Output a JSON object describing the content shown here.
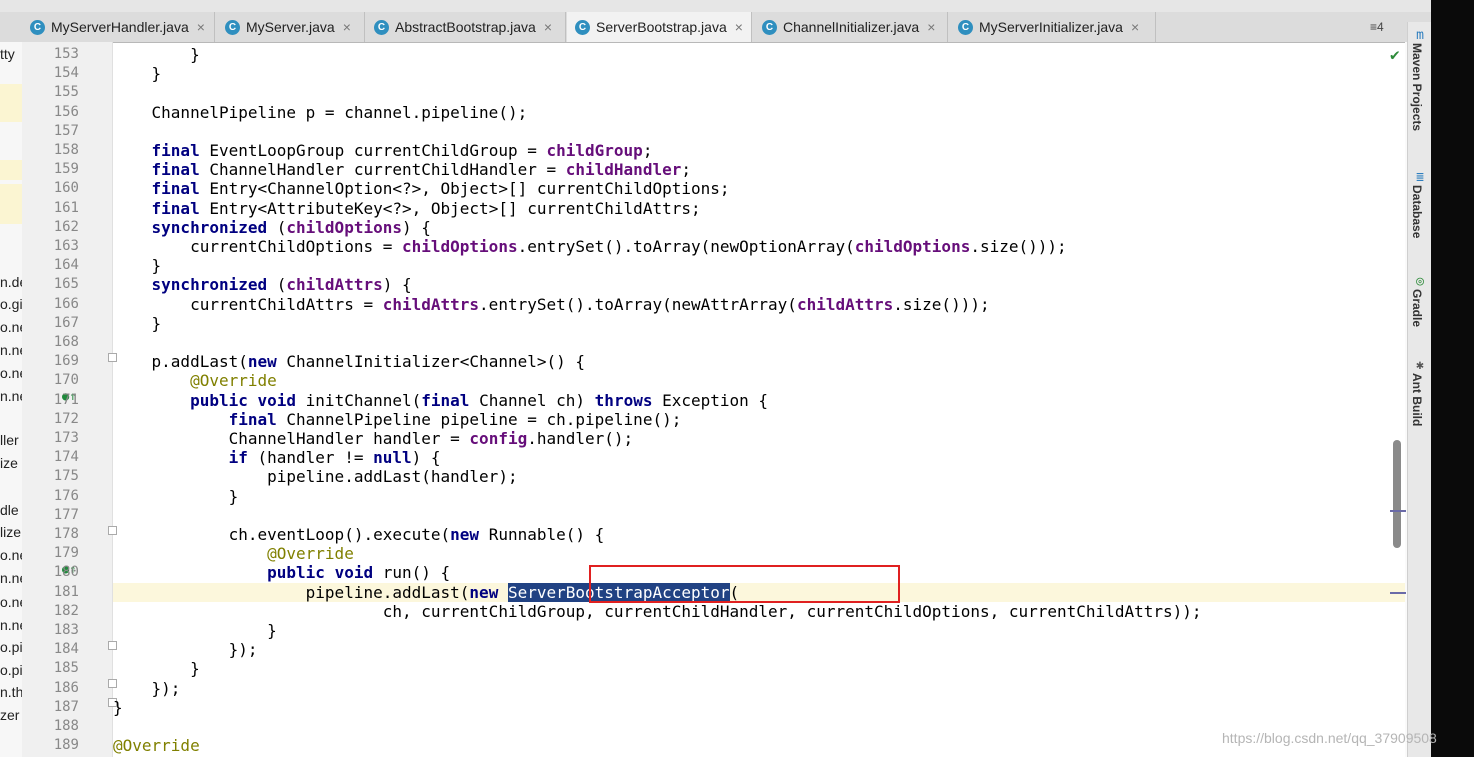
{
  "tabs": [
    {
      "label": "MyServerHandler.java",
      "active": false
    },
    {
      "label": "MyServer.java",
      "active": false
    },
    {
      "label": "AbstractBootstrap.java",
      "active": false
    },
    {
      "label": "ServerBootstrap.java",
      "active": true
    },
    {
      "label": "ChannelInitializer.java",
      "active": false
    },
    {
      "label": "MyServerInitializer.java",
      "active": false
    }
  ],
  "tab_menu": "≡4",
  "project_fragments": [
    "tty",
    "n.de",
    "o.gi",
    "o.ne",
    "n.ne",
    "o.ne",
    "n.ne",
    "ller",
    "ize",
    "dle",
    "lize",
    "o.ne",
    "n.ne",
    "o.ne",
    "n.ne",
    "o.pi",
    "o.pi",
    "n.th",
    "zer"
  ],
  "tool_windows": [
    "Maven Projects",
    "Database",
    "Gradle",
    "Ant Build"
  ],
  "watermark": "https://blog.csdn.net/qq_37909508",
  "code_lines": [
    {
      "n": "153",
      "t": "        }"
    },
    {
      "n": "154",
      "t": "    }"
    },
    {
      "n": "155",
      "t": ""
    },
    {
      "n": "156",
      "t": "    ChannelPipeline p = channel.pipeline();"
    },
    {
      "n": "157",
      "t": ""
    },
    {
      "n": "158",
      "t": "    final EventLoopGroup currentChildGroup = childGroup;"
    },
    {
      "n": "159",
      "t": "    final ChannelHandler currentChildHandler = childHandler;"
    },
    {
      "n": "160",
      "t": "    final Entry<ChannelOption<?>, Object>[] currentChildOptions;"
    },
    {
      "n": "161",
      "t": "    final Entry<AttributeKey<?>, Object>[] currentChildAttrs;"
    },
    {
      "n": "162",
      "t": "    synchronized (childOptions) {"
    },
    {
      "n": "163",
      "t": "        currentChildOptions = childOptions.entrySet().toArray(newOptionArray(childOptions.size()));"
    },
    {
      "n": "164",
      "t": "    }"
    },
    {
      "n": "165",
      "t": "    synchronized (childAttrs) {"
    },
    {
      "n": "166",
      "t": "        currentChildAttrs = childAttrs.entrySet().toArray(newAttrArray(childAttrs.size()));"
    },
    {
      "n": "167",
      "t": "    }"
    },
    {
      "n": "168",
      "t": ""
    },
    {
      "n": "169",
      "t": "    p.addLast(new ChannelInitializer<Channel>() {"
    },
    {
      "n": "170",
      "t": "        @Override"
    },
    {
      "n": "171",
      "t": "        public void initChannel(final Channel ch) throws Exception {"
    },
    {
      "n": "172",
      "t": "            final ChannelPipeline pipeline = ch.pipeline();"
    },
    {
      "n": "173",
      "t": "            ChannelHandler handler = config.handler();"
    },
    {
      "n": "174",
      "t": "            if (handler != null) {"
    },
    {
      "n": "175",
      "t": "                pipeline.addLast(handler);"
    },
    {
      "n": "176",
      "t": "            }"
    },
    {
      "n": "177",
      "t": ""
    },
    {
      "n": "178",
      "t": "            ch.eventLoop().execute(new Runnable() {"
    },
    {
      "n": "179",
      "t": "                @Override"
    },
    {
      "n": "180",
      "t": "                public void run() {"
    },
    {
      "n": "181",
      "t": "                    pipeline.addLast(new ServerBootstrapAcceptor("
    },
    {
      "n": "182",
      "t": "                            ch, currentChildGroup, currentChildHandler, currentChildOptions, currentChildAttrs));"
    },
    {
      "n": "183",
      "t": "                }"
    },
    {
      "n": "184",
      "t": "            });"
    },
    {
      "n": "185",
      "t": "        }"
    },
    {
      "n": "186",
      "t": "    });"
    },
    {
      "n": "187",
      "t": "}"
    },
    {
      "n": "188",
      "t": ""
    },
    {
      "n": "189",
      "t": "@Override"
    }
  ],
  "selected_text": "ServerBootstrapAcceptor"
}
